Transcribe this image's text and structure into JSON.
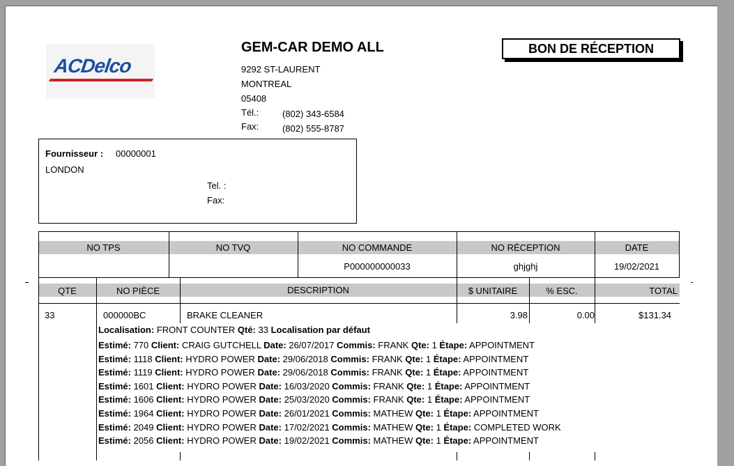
{
  "company": {
    "name": "GEM-CAR DEMO ALL",
    "address": "9292 ST-LAURENT",
    "city": "MONTREAL",
    "postal": "05408",
    "tel_label": "Tél.:",
    "tel": "(802) 343-6584",
    "fax_label": "Fax:",
    "fax": "(802) 555-8787"
  },
  "logo": {
    "text": "ACDelco"
  },
  "doc_title": "BON DE RÉCEPTION",
  "supplier": {
    "label": "Fournisseur :",
    "number": "00000001",
    "name": "LONDON",
    "tel_label": "Tel. :",
    "fax_label": "Fax:"
  },
  "order_header": {
    "columns": [
      "NO TPS",
      "NO TVQ",
      "NO COMMANDE",
      "NO RÉCEPTION",
      "DATE"
    ],
    "values": [
      "",
      "",
      "P000000000033",
      "ghjghj",
      "19/02/2021"
    ]
  },
  "items_header": [
    "QTE",
    "NO PIÈCE",
    "DESCRIPTION",
    "$ UNITAIRE",
    "% ESC.",
    "TOTAL"
  ],
  "item": {
    "qty": "33",
    "part": "000000BC",
    "description": "BRAKE CLEANER",
    "unit_price": "3.98",
    "discount": "0.00",
    "total": "$131.34"
  },
  "location": {
    "label": "Localisation:",
    "value": "FRONT COUNTER",
    "qty_label": "Qté:",
    "qty": "33",
    "default_label": "Localisation par défaut"
  },
  "labels": {
    "estimate": "Estimé:",
    "client": "Client:",
    "date": "Date:",
    "commis": "Commis:",
    "qty": "Qte:",
    "step": "Étape:"
  },
  "estimates": [
    {
      "no": "770",
      "client": "CRAIG GUTCHELL",
      "date": "26/07/2017",
      "commis": "FRANK",
      "qty": "1",
      "step": "APPOINTMENT"
    },
    {
      "no": "1118",
      "client": "HYDRO POWER",
      "date": "29/06/2018",
      "commis": "FRANK",
      "qty": "1",
      "step": "APPOINTMENT"
    },
    {
      "no": "1119",
      "client": "HYDRO POWER",
      "date": "29/06/2018",
      "commis": "FRANK",
      "qty": "1",
      "step": "APPOINTMENT"
    },
    {
      "no": "1601",
      "client": "HYDRO POWER",
      "date": "16/03/2020",
      "commis": "FRANK",
      "qty": "1",
      "step": "APPOINTMENT"
    },
    {
      "no": "1606",
      "client": "HYDRO POWER",
      "date": "25/03/2020",
      "commis": "FRANK",
      "qty": "1",
      "step": "APPOINTMENT"
    },
    {
      "no": "1964",
      "client": "HYDRO POWER",
      "date": "26/01/2021",
      "commis": "MATHEW",
      "qty": "1",
      "step": "APPOINTMENT"
    },
    {
      "no": "2049",
      "client": "HYDRO POWER",
      "date": "17/02/2021",
      "commis": "MATHEW",
      "qty": "1",
      "step": "COMPLETED WORK"
    },
    {
      "no": "2056",
      "client": "HYDRO POWER",
      "date": "19/02/2021",
      "commis": "MATHEW",
      "qty": "1",
      "step": "APPOINTMENT"
    }
  ]
}
